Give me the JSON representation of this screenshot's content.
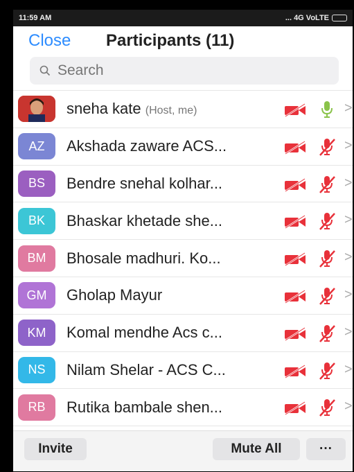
{
  "status": {
    "time": "11:59 AM",
    "network": "... 4G VoLTE"
  },
  "header": {
    "close_label": "Close",
    "title": "Participants (11)"
  },
  "search": {
    "placeholder": "Search"
  },
  "participants": [
    {
      "initials": "",
      "name": "sneha kate",
      "tag": "(Host, me)",
      "avatar_color": "#d9534f",
      "photo": true,
      "video_off": true,
      "mic_muted": false
    },
    {
      "initials": "AZ",
      "name": "Akshada zaware ACS...",
      "tag": "",
      "avatar_color": "#7b86d4",
      "video_off": true,
      "mic_muted": true
    },
    {
      "initials": "BS",
      "name": "Bendre snehal kolhar...",
      "tag": "",
      "avatar_color": "#9b5fc0",
      "video_off": true,
      "mic_muted": true
    },
    {
      "initials": "BK",
      "name": "Bhaskar khetade she...",
      "tag": "",
      "avatar_color": "#3cc6d6",
      "video_off": true,
      "mic_muted": true
    },
    {
      "initials": "BM",
      "name": "Bhosale madhuri.  Ko...",
      "tag": "",
      "avatar_color": "#e07aa0",
      "video_off": true,
      "mic_muted": true
    },
    {
      "initials": "GM",
      "name": "Gholap Mayur",
      "tag": "",
      "avatar_color": "#b074d6",
      "video_off": true,
      "mic_muted": true
    },
    {
      "initials": "KM",
      "name": "Komal mendhe Acs c...",
      "tag": "",
      "avatar_color": "#8e63c9",
      "video_off": true,
      "mic_muted": true
    },
    {
      "initials": "NS",
      "name": "Nilam Shelar - ACS C...",
      "tag": "",
      "avatar_color": "#33b8e8",
      "video_off": true,
      "mic_muted": true
    },
    {
      "initials": "RB",
      "name": "Rutika bambale shen...",
      "tag": "",
      "avatar_color": "#e07aa0",
      "video_off": true,
      "mic_muted": true
    }
  ],
  "footer": {
    "invite_label": "Invite",
    "mute_all_label": "Mute All",
    "more_label": "···"
  },
  "colors": {
    "accent": "#2d8cff",
    "muted_red": "#e8313a",
    "mic_green": "#8ac34a"
  },
  "icons": {
    "video": "video-off-icon",
    "mic": "mic-icon",
    "chevron": "chevron-right-icon",
    "search": "search-icon"
  }
}
